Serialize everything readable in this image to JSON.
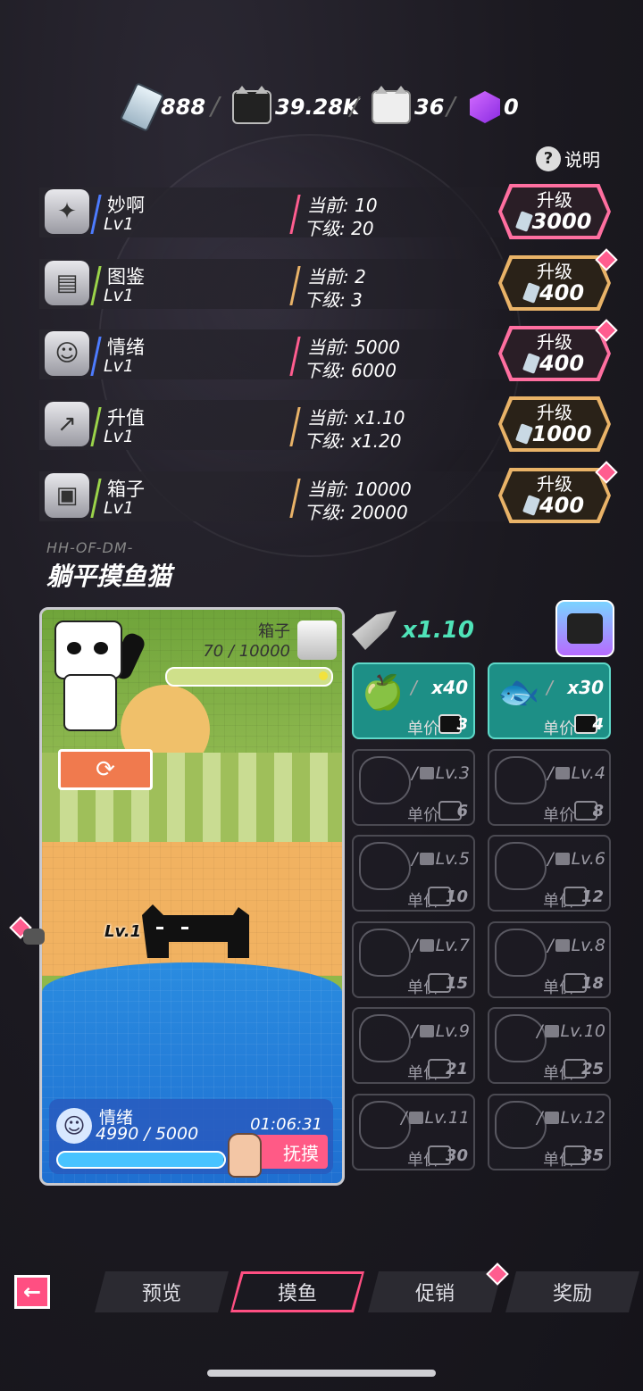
{
  "resources": [
    {
      "icon": "milk-carton-icon",
      "value": "888"
    },
    {
      "icon": "black-cat-box-icon",
      "value": "39.28K"
    },
    {
      "icon": "white-cat-box-icon",
      "value": "36"
    },
    {
      "icon": "purple-cube-icon",
      "value": "0"
    }
  ],
  "help_label": "说明",
  "upgrades": [
    {
      "name": "妙啊",
      "level": "Lv1",
      "current": "当前: 10",
      "next": "下级: 20",
      "button_label": "升级",
      "cost": "3000",
      "style": "pink",
      "has_dot": false,
      "icon": "lightbulb-icon"
    },
    {
      "name": "图鉴",
      "level": "Lv1",
      "current": "当前: 2",
      "next": "下级: 3",
      "button_label": "升级",
      "cost": "400",
      "style": "gold",
      "has_dot": true,
      "icon": "book-icon"
    },
    {
      "name": "情绪",
      "level": "Lv1",
      "current": "当前: 5000",
      "next": "下级: 6000",
      "button_label": "升级",
      "cost": "400",
      "style": "pink",
      "has_dot": true,
      "icon": "smiley-icon"
    },
    {
      "name": "升值",
      "level": "Lv1",
      "current": "当前: x1.10",
      "next": "下级: x1.20",
      "button_label": "升级",
      "cost": "1000",
      "style": "gold",
      "has_dot": false,
      "icon": "trend-arrow-icon"
    },
    {
      "name": "箱子",
      "level": "Lv1",
      "current": "当前: 10000",
      "next": "下级: 20000",
      "button_label": "升级",
      "cost": "400",
      "style": "gold",
      "has_dot": true,
      "icon": "box-icon"
    }
  ],
  "subtitle": "HH-OF-DM-",
  "title": "躺平摸鱼猫",
  "game": {
    "box_label": "箱子",
    "box_value": "70 / 10000",
    "cat_level": "Lv.1",
    "mood_label": "情绪",
    "mood_value": "4990 / 5000",
    "mood_fraction": 0.998,
    "timer": "01:06:31",
    "pet_label": "抚摸"
  },
  "multiplier": "x1.10",
  "items": [
    {
      "unlocked": true,
      "icon": "apple-core-icon",
      "count": "x40",
      "price_label": "单价",
      "price": "3"
    },
    {
      "unlocked": true,
      "icon": "fish-bone-icon",
      "count": "x30",
      "price_label": "单价",
      "price": "4"
    },
    {
      "unlocked": false,
      "level": "Lv.3",
      "price_label": "单价",
      "price": "6"
    },
    {
      "unlocked": false,
      "level": "Lv.4",
      "price_label": "单价",
      "price": "8"
    },
    {
      "unlocked": false,
      "level": "Lv.5",
      "price_label": "单价",
      "price": "10"
    },
    {
      "unlocked": false,
      "level": "Lv.6",
      "price_label": "单价",
      "price": "12"
    },
    {
      "unlocked": false,
      "level": "Lv.7",
      "price_label": "单价",
      "price": "15"
    },
    {
      "unlocked": false,
      "level": "Lv.8",
      "price_label": "单价",
      "price": "18"
    },
    {
      "unlocked": false,
      "level": "Lv.9",
      "price_label": "单价",
      "price": "21"
    },
    {
      "unlocked": false,
      "level": "Lv.10",
      "price_label": "单价",
      "price": "25"
    },
    {
      "unlocked": false,
      "level": "Lv.11",
      "price_label": "单价",
      "price": "30"
    },
    {
      "unlocked": false,
      "level": "Lv.12",
      "price_label": "单价",
      "price": "35"
    }
  ],
  "nav": {
    "back_icon": "back-arrow-icon",
    "tabs": [
      {
        "label": "预览",
        "active": false,
        "has_dot": false
      },
      {
        "label": "摸鱼",
        "active": true,
        "has_dot": false
      },
      {
        "label": "促销",
        "active": false,
        "has_dot": true
      },
      {
        "label": "奖励",
        "active": false,
        "has_dot": false
      }
    ]
  },
  "colors": {
    "pink": "#ff4f82",
    "gold": "#e9b368",
    "teal": "#1d8f86",
    "mint": "#4fe3b8"
  }
}
